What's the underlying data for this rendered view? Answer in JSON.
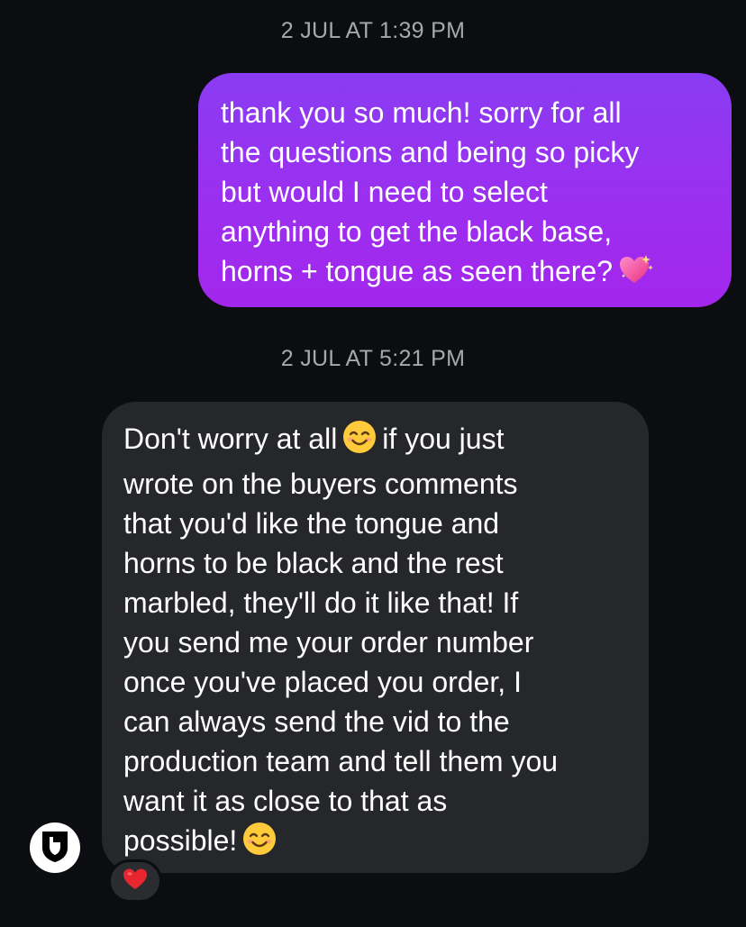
{
  "thread": {
    "timestamp_1": "2 JUL AT 1:39 PM",
    "timestamp_2": "2 JUL AT 5:21 PM"
  },
  "outgoing": {
    "lines": [
      "thank you so much! sorry for all",
      "the questions and being so picky",
      "but would I need to select",
      "anything to get the black base,",
      "horns + tongue as seen there?"
    ],
    "trailing_emoji": "sparkling-heart-icon",
    "bubble_color": "#9b2ff0"
  },
  "incoming": {
    "line1_before": "Don't worry at all",
    "line1_emoji": "smiling-face-icon",
    "line1_after": "if you just",
    "lines": [
      "wrote on the buyers comments",
      "that you'd like the tongue and",
      "horns to be black and the rest",
      "marbled, they'll do it like that! If",
      "you send me your order number",
      "once you've placed you order, I",
      "can always send the vid to the",
      "production team and tell them you",
      "want it as close to that as"
    ],
    "last_line": "possible!",
    "last_emoji": "smiling-face-icon",
    "bubble_color": "#26272b",
    "reaction": "red-heart-icon"
  },
  "sender": {
    "avatar": "shield-logo-icon"
  }
}
